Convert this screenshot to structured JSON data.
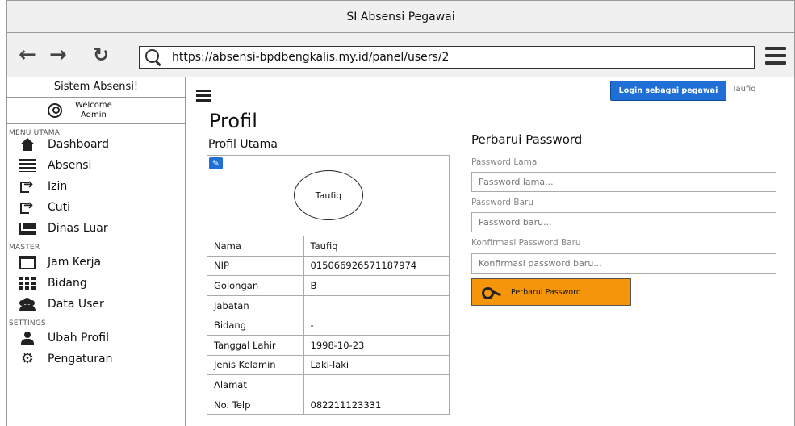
{
  "window": {
    "title": "SI Absensi Pegawai"
  },
  "browser": {
    "back_icon": "back-arrow-icon",
    "forward_icon": "forward-arrow-icon",
    "reload_icon": "reload-icon",
    "url": "https://absensi-bpdbengkalis.my.id/panel/users/2"
  },
  "sidebar": {
    "title": "Sistem Absensi!",
    "welcome_line1": "Welcome",
    "welcome_line2": "Admin",
    "sections": {
      "main": "MENU UTAMA",
      "master": "MASTER",
      "settings": "SETTINGS"
    },
    "items": [
      {
        "label": "Dashboard",
        "icon": "home-icon"
      },
      {
        "label": "Absensi",
        "icon": "list-icon"
      },
      {
        "label": "Izin",
        "icon": "sign-out-icon"
      },
      {
        "label": "Cuti",
        "icon": "sign-out-icon"
      },
      {
        "label": "Dinas Luar",
        "icon": "envelope-icon"
      },
      {
        "label": "Jam Kerja",
        "icon": "calendar-icon"
      },
      {
        "label": "Bidang",
        "icon": "grid-icon"
      },
      {
        "label": "Data User",
        "icon": "users-icon"
      },
      {
        "label": "Ubah Profil",
        "icon": "user-icon"
      },
      {
        "label": "Pengaturan",
        "icon": "gear-icon"
      }
    ]
  },
  "topbar": {
    "login_as_employee": "Login sebagai pegawai",
    "username": "Taufiq"
  },
  "profile": {
    "page_title": "Profil",
    "section_title": "Profil Utama",
    "avatar_name": "Taufiq",
    "rows": [
      {
        "label": "Nama",
        "value": "Taufiq"
      },
      {
        "label": "NIP",
        "value": "015066926571187974"
      },
      {
        "label": "Golongan",
        "value": "B"
      },
      {
        "label": "Jabatan",
        "value": ""
      },
      {
        "label": "Bidang",
        "value": "-"
      },
      {
        "label": "Tanggal Lahir",
        "value": "1998-10-23"
      },
      {
        "label": "Jenis Kelamin",
        "value": "Laki-laki"
      },
      {
        "label": "Alamat",
        "value": ""
      },
      {
        "label": "No. Telp",
        "value": "082211123331"
      }
    ]
  },
  "password": {
    "title": "Perbarui Password",
    "old_label": "Password Lama",
    "old_placeholder": "Password lama...",
    "new_label": "Password Baru",
    "new_placeholder": "Password baru...",
    "confirm_label": "Konfirmasi Password Baru",
    "confirm_placeholder": "Konfirmasi password baru...",
    "submit_label": "Perbarui Password"
  },
  "colors": {
    "primary_button": "#1f6fd6",
    "submit_button": "#f5960a"
  }
}
